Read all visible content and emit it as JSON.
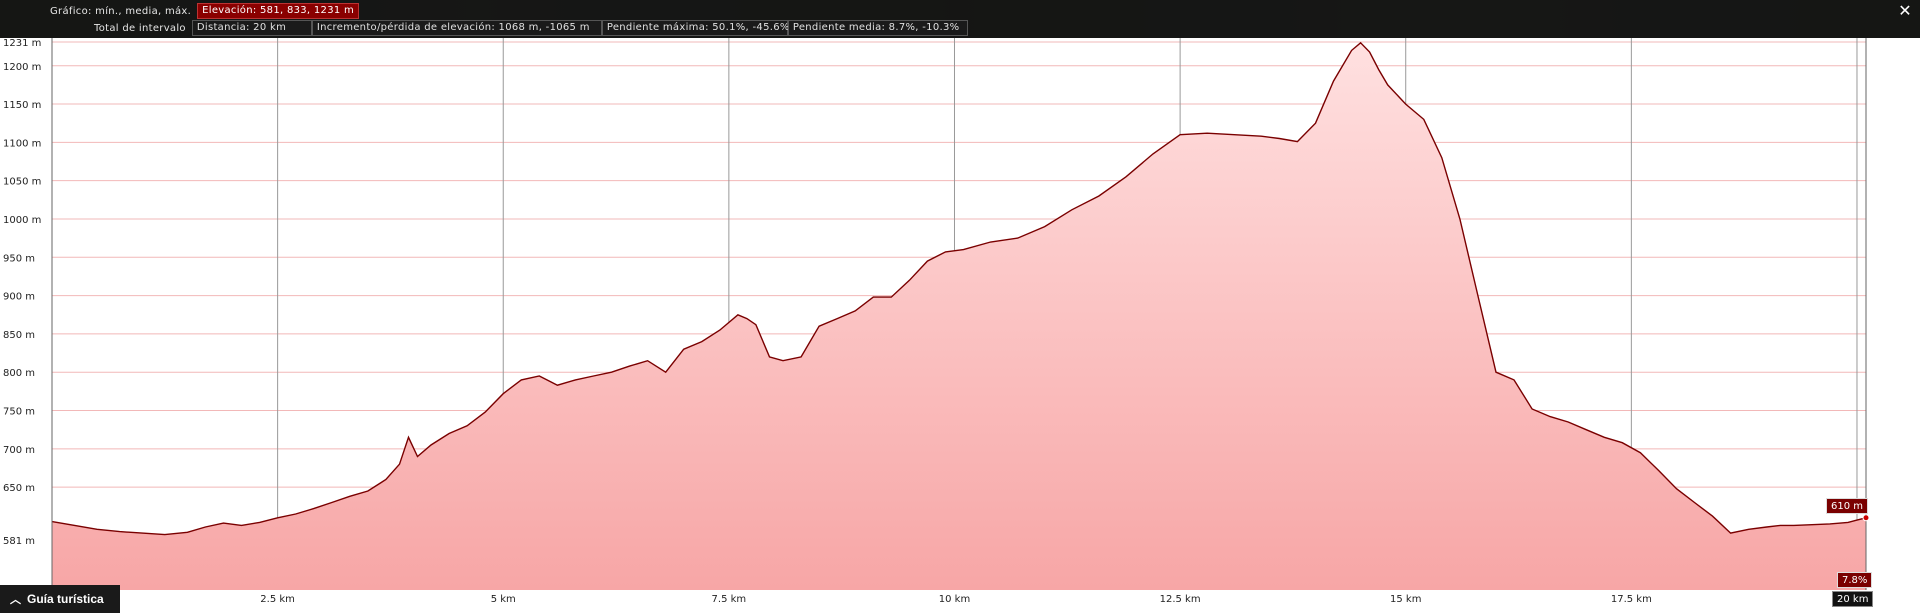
{
  "header": {
    "graph_label": "Gráfico: mín., media, máx.",
    "elevation": "Elevación: 581, 833, 1231 m",
    "interval_label": "Total de intervalo",
    "distance": "Distancia: 20 km",
    "gain_loss": "Incremento/pérdida de elevación: 1068 m, -1065 m",
    "max_slope": "Pendiente máxima: 50.1%, -45.6%",
    "avg_slope": "Pendiente media: 8.7%, -10.3%"
  },
  "close_icon": "close-icon",
  "guide": {
    "label": "Guía turística",
    "icon": "chevron-up-icon"
  },
  "badges": {
    "elev_marker": "610 m",
    "slope_marker": "7.8%",
    "distance_marker": "20 km"
  },
  "colors": {
    "fill_top": "#ffe0e0",
    "fill_bottom": "#f7a6a6",
    "line": "#7a0000",
    "grid": "#f2b8b8",
    "badge": "#7a0000"
  },
  "chart_data": {
    "type": "area",
    "xlabel": "",
    "ylabel": "",
    "xlim": [
      0,
      20.1
    ],
    "ylim": [
      581,
      1231
    ],
    "x_ticks": [
      {
        "v": 2.5,
        "label": "2.5 km"
      },
      {
        "v": 5,
        "label": "5 km"
      },
      {
        "v": 7.5,
        "label": "7.5 km"
      },
      {
        "v": 10,
        "label": "10 km"
      },
      {
        "v": 12.5,
        "label": "12.5 km"
      },
      {
        "v": 15,
        "label": "15 km"
      },
      {
        "v": 17.5,
        "label": "17.5 km"
      },
      {
        "v": 20,
        "label": "20 km"
      }
    ],
    "y_ticks": [
      {
        "v": 1231,
        "label": "1231 m"
      },
      {
        "v": 1200,
        "label": "1200 m"
      },
      {
        "v": 1150,
        "label": "1150 m"
      },
      {
        "v": 1100,
        "label": "1100 m"
      },
      {
        "v": 1050,
        "label": "1050 m"
      },
      {
        "v": 1000,
        "label": "1000 m"
      },
      {
        "v": 950,
        "label": "950 m"
      },
      {
        "v": 900,
        "label": "900 m"
      },
      {
        "v": 850,
        "label": "850 m"
      },
      {
        "v": 800,
        "label": "800 m"
      },
      {
        "v": 750,
        "label": "750 m"
      },
      {
        "v": 700,
        "label": "700 m"
      },
      {
        "v": 650,
        "label": "650 m"
      },
      {
        "v": 581,
        "label": "581 m"
      }
    ],
    "grid": true,
    "series": [
      {
        "x": [
          0,
          0.25,
          0.5,
          0.75,
          1.0,
          1.25,
          1.5,
          1.7,
          1.9,
          2.1,
          2.3,
          2.5,
          2.7,
          2.9,
          3.1,
          3.3,
          3.5,
          3.7,
          3.85,
          3.95,
          4.05,
          4.2,
          4.4,
          4.6,
          4.8,
          5.0,
          5.2,
          5.4,
          5.6,
          5.8,
          6.0,
          6.2,
          6.4,
          6.6,
          6.8,
          7.0,
          7.2,
          7.4,
          7.6,
          7.7,
          7.8,
          7.95,
          8.1,
          8.3,
          8.5,
          8.7,
          8.9,
          9.1,
          9.3,
          9.5,
          9.7,
          9.9,
          10.1,
          10.4,
          10.7,
          11.0,
          11.3,
          11.6,
          11.9,
          12.2,
          12.5,
          12.8,
          13.1,
          13.4,
          13.6,
          13.8,
          14.0,
          14.2,
          14.4,
          14.5,
          14.6,
          14.7,
          14.8,
          15.0,
          15.2,
          15.4,
          15.6,
          15.8,
          16.0,
          16.2,
          16.4,
          16.6,
          16.8,
          17.0,
          17.2,
          17.4,
          17.6,
          17.8,
          18.0,
          18.2,
          18.4,
          18.6,
          18.8,
          19.0,
          19.15,
          19.3,
          19.5,
          19.7,
          19.9,
          20.0,
          20.1
        ],
        "y": [
          605,
          600,
          595,
          592,
          590,
          588,
          591,
          598,
          603,
          600,
          604,
          610,
          615,
          622,
          630,
          638,
          645,
          660,
          680,
          715,
          690,
          705,
          720,
          730,
          748,
          772,
          790,
          795,
          783,
          790,
          795,
          800,
          808,
          815,
          800,
          830,
          840,
          855,
          875,
          870,
          862,
          820,
          815,
          820,
          860,
          870,
          880,
          898,
          898,
          920,
          945,
          957,
          960,
          970,
          975,
          990,
          1012,
          1030,
          1055,
          1085,
          1110,
          1112,
          1110,
          1108,
          1105,
          1101,
          1125,
          1180,
          1220,
          1230,
          1218,
          1195,
          1175,
          1150,
          1130,
          1080,
          1000,
          900,
          800,
          790,
          752,
          742,
          735,
          725,
          715,
          708,
          695,
          672,
          648,
          630,
          612,
          590,
          595,
          598,
          600,
          600,
          601,
          602,
          604,
          607,
          610
        ]
      }
    ]
  }
}
